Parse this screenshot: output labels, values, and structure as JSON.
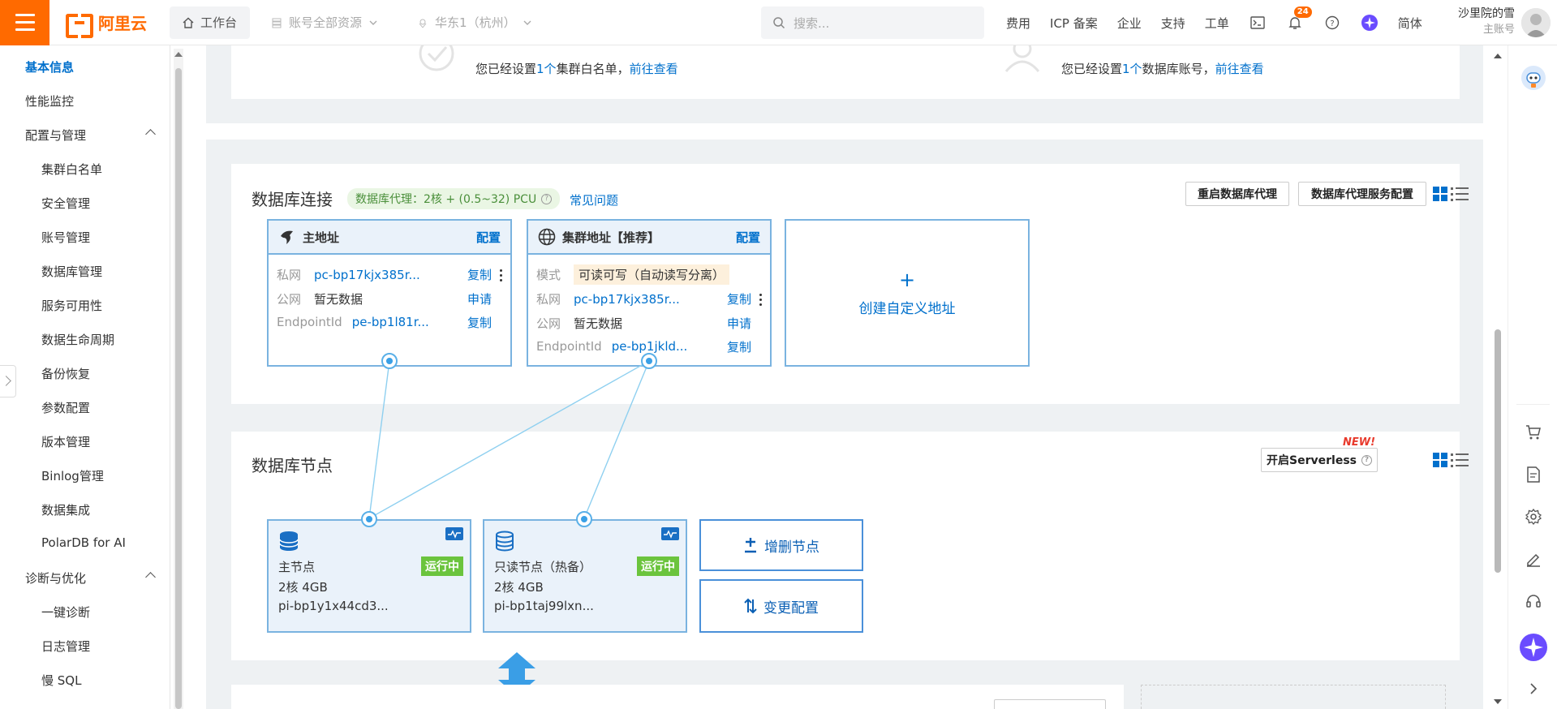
{
  "topbar": {
    "logo_text": "阿里云",
    "workbench": "工作台",
    "resources": "账号全部资源",
    "region": "华东1（杭州）",
    "search_placeholder": "搜索...",
    "links": [
      "费用",
      "ICP 备案",
      "企业",
      "支持",
      "工单"
    ],
    "notification_count": "24",
    "language": "简体",
    "user_name": "沙里院的雪",
    "user_role": "主账号"
  },
  "sidebar": {
    "items": [
      {
        "label": "基本信息",
        "level": "top",
        "active": true
      },
      {
        "label": "性能监控",
        "level": "top"
      },
      {
        "label": "配置与管理",
        "level": "group"
      },
      {
        "label": "集群白名单",
        "level": "sub"
      },
      {
        "label": "安全管理",
        "level": "sub"
      },
      {
        "label": "账号管理",
        "level": "sub"
      },
      {
        "label": "数据库管理",
        "level": "sub"
      },
      {
        "label": "服务可用性",
        "level": "sub"
      },
      {
        "label": "数据生命周期",
        "level": "sub"
      },
      {
        "label": "备份恢复",
        "level": "sub"
      },
      {
        "label": "参数配置",
        "level": "sub"
      },
      {
        "label": "版本管理",
        "level": "sub"
      },
      {
        "label": "Binlog管理",
        "level": "sub"
      },
      {
        "label": "数据集成",
        "level": "sub"
      },
      {
        "label": "PolarDB for AI",
        "level": "sub"
      },
      {
        "label": "诊断与优化",
        "level": "group"
      },
      {
        "label": "一键诊断",
        "level": "sub"
      },
      {
        "label": "日志管理",
        "level": "sub"
      },
      {
        "label": "慢 SQL",
        "level": "sub"
      }
    ]
  },
  "top_cards": {
    "whitelist_prefix": "您已经设置",
    "whitelist_count": "1个",
    "whitelist_suffix": "集群白名单，",
    "whitelist_link": "前往查看",
    "account_prefix": "您已经设置",
    "account_count": "1个",
    "account_suffix": "数据库账号，",
    "account_link": "前往查看"
  },
  "db_connection": {
    "title": "数据库连接",
    "proxy_pill": "数据库代理：2核 + (0.5~32) PCU",
    "faq_link": "常见问题",
    "restart_proxy": "重启数据库代理",
    "proxy_config": "数据库代理服务配置",
    "primary": {
      "title": "主地址",
      "config": "配置",
      "rows": [
        {
          "key": "私网",
          "value": "pc-bp17kjx385r...",
          "action": "复制"
        },
        {
          "key": "公网",
          "value": "暂无数据",
          "action": "申请"
        },
        {
          "key": "EndpointId",
          "value": "pe-bp1l81r...",
          "action": "复制"
        }
      ]
    },
    "cluster": {
      "title": "集群地址【推荐】",
      "config": "配置",
      "mode_key": "模式",
      "mode_value": "可读可写（自动读写分离）",
      "rows": [
        {
          "key": "私网",
          "value": "pc-bp17kjx385r...",
          "action": "复制"
        },
        {
          "key": "公网",
          "value": "暂无数据",
          "action": "申请"
        },
        {
          "key": "EndpointId",
          "value": "pe-bp1jkld...",
          "action": "复制"
        }
      ]
    },
    "custom": {
      "plus": "+",
      "label": "创建自定义地址"
    }
  },
  "db_nodes": {
    "title": "数据库节点",
    "serverless_btn": "开启Serverless",
    "new_badge": "NEW!",
    "nodes": [
      {
        "name": "主节点",
        "spec": "2核 4GB",
        "id": "pi-bp1y1x44cd3...",
        "status": "运行中"
      },
      {
        "name": "只读节点（热备）",
        "spec": "2核 4GB",
        "id": "pi-bp1taj99lxn...",
        "status": "运行中"
      }
    ],
    "add_remove": "增删节点",
    "change_config": "变更配置"
  },
  "colors": {
    "brand": "#ff6a00",
    "link": "#0070cc",
    "running": "#6bc43d",
    "card_border": "#7ab3e0"
  }
}
